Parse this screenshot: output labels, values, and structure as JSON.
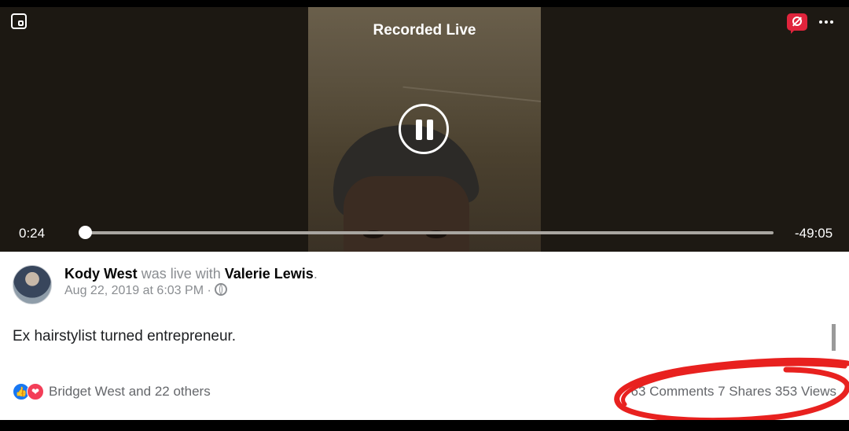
{
  "player": {
    "title": "Recorded Live",
    "elapsed": "0:24",
    "remaining": "-49:05",
    "progress": 0.008
  },
  "post": {
    "author": "Kody West",
    "live_text": " was live with ",
    "with_user": "Valerie Lewis",
    "period": ".",
    "date": "Aug 22, 2019 at 6:03 PM",
    "separator": " · ",
    "audience_icon": "globe-icon",
    "caption": "Ex hairstylist turned entrepreneur."
  },
  "engagement": {
    "reactors": "Bridget West and 22 others",
    "comments": "63 Comments",
    "shares": "7 Shares",
    "views": "353 Views"
  },
  "colors": {
    "accent_red": "#e0243c",
    "like_blue": "#1877f2",
    "love_red": "#f33e58",
    "annotation_red": "#e8211f"
  }
}
